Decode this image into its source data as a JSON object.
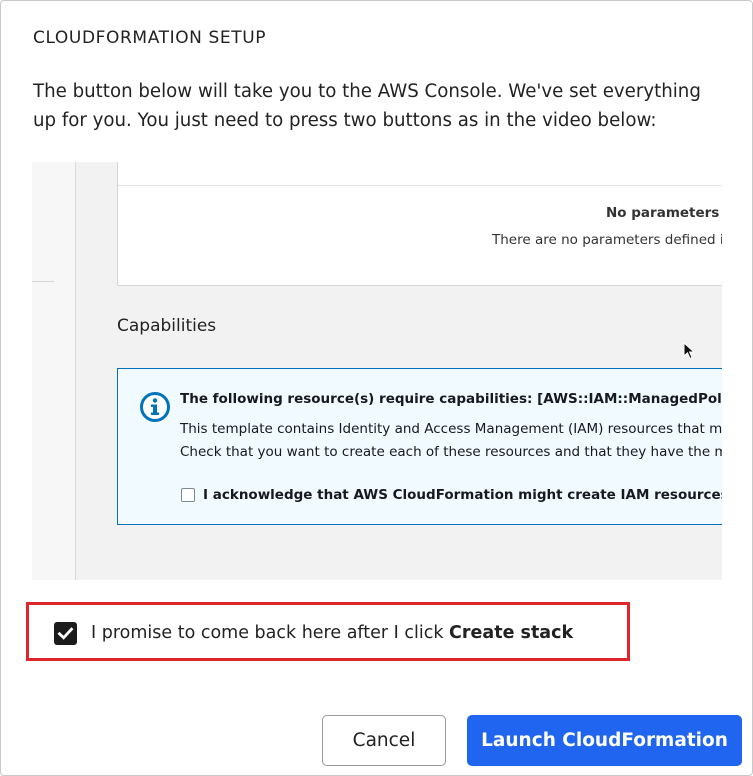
{
  "modal": {
    "title": "CLOUDFORMATION SETUP",
    "intro": "The button below will take you to the AWS Console. We've set everything up for you. You just need to press two buttons as in the video below:"
  },
  "video": {
    "no_params_title": "No parameters",
    "no_params_desc": "There are no parameters defined in",
    "capabilities_heading": "Capabilities",
    "info_title": "The following resource(s) require capabilities: [AWS::IAM::ManagedPolicy]",
    "info_line1": "This template contains Identity and Access Management (IAM) resources that migh",
    "info_line2": "Check that you want to create each of these resources and that they have the minir",
    "ack_label": "I acknowledge that AWS CloudFormation might create IAM resources.",
    "icons": [
      "info-icon",
      "mouse-cursor-icon"
    ],
    "accent_color": "#0073bb"
  },
  "promise": {
    "label_prefix": "I promise to come back here after I click ",
    "label_bold": "Create stack",
    "checked": true,
    "highlight_color": "#e0262d"
  },
  "actions": {
    "cancel_label": "Cancel",
    "launch_label": "Launch CloudFormation",
    "launch_color": "#1f65ef"
  }
}
